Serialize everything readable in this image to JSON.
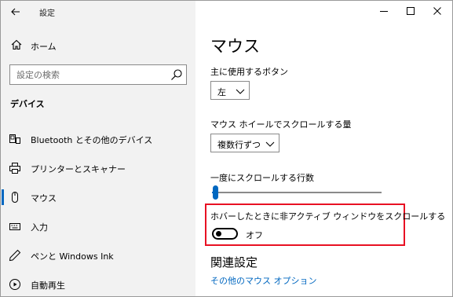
{
  "titlebar": {
    "title": "設定",
    "back_icon": "back-arrow-icon",
    "minimize_icon": "minimize-icon",
    "maximize_icon": "maximize-icon",
    "close_icon": "close-icon"
  },
  "sidebar": {
    "home_label": "ホーム",
    "home_icon": "home-icon",
    "search": {
      "placeholder": "設定の検索",
      "icon": "search-icon"
    },
    "section_header": "デバイス",
    "items": [
      {
        "label": "Bluetooth とその他のデバイス",
        "icon": "bluetooth-devices-icon",
        "selected": false
      },
      {
        "label": "プリンターとスキャナー",
        "icon": "printer-icon",
        "selected": false
      },
      {
        "label": "マウス",
        "icon": "mouse-icon",
        "selected": true
      },
      {
        "label": "入力",
        "icon": "keyboard-icon",
        "selected": false
      },
      {
        "label": "ペンと Windows Ink",
        "icon": "pen-icon",
        "selected": false
      },
      {
        "label": "自動再生",
        "icon": "autoplay-icon",
        "selected": false
      }
    ]
  },
  "main": {
    "title": "マウス",
    "primary_button": {
      "label": "主に使用するボタン",
      "value": "左"
    },
    "wheel_scroll": {
      "label": "マウス ホイールでスクロールする量",
      "value": "複数行ずつ"
    },
    "lines_to_scroll": {
      "label": "一度にスクロールする行数",
      "value_fraction": 0.02
    },
    "inactive_scroll": {
      "label": "ホバーしたときに非アクティブ ウィンドウをスクロールする",
      "state_label": "オフ",
      "on": false
    },
    "related_header": "関連設定",
    "related_link": "その他のマウス オプション"
  },
  "colors": {
    "accent": "#0067c0",
    "highlight": "#e81123",
    "sidebar_bg": "#f2f2f2"
  }
}
